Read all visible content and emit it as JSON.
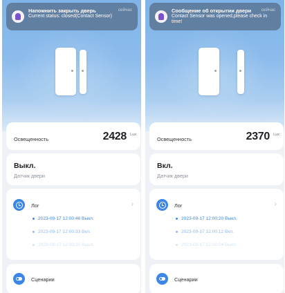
{
  "left": {
    "notification": {
      "title": "Напомнить закрыть дверь",
      "body": "Current status: closed(Contact Sensor)",
      "time": "сейчас"
    },
    "illuminance": {
      "label": "Освещенность",
      "value": "2428",
      "unit": "Lux"
    },
    "status": {
      "title": "Выкл.",
      "subtitle": "Датчик двери"
    },
    "log": {
      "label": "Лог",
      "entries": [
        "2023-09-17 12:00:46 Выкл.",
        "2023-09-17 12:00:33 Вкл.",
        "2023-09-17 12:00:20 Выкл."
      ]
    },
    "scenarios": {
      "label": "Сценарии"
    }
  },
  "right": {
    "notification": {
      "title": "Сообщение об открытии двери",
      "body": "Contact Sensor was opened,please check in time!",
      "time": "сейчас"
    },
    "illuminance": {
      "label": "Освещенность",
      "value": "2370",
      "unit": "Lux"
    },
    "status": {
      "title": "Вкл.",
      "subtitle": "Датчик двери"
    },
    "log": {
      "label": "Лог",
      "entries": [
        "2023-09-17 12:00:20 Выкл.",
        "2023-09-17 12:00:12 Вкл.",
        "2023-09-17 12:00:04 Выкл."
      ]
    },
    "scenarios": {
      "label": "Сценарии"
    }
  },
  "icons": {
    "app": "lightbulb-icon",
    "log": "clock-icon",
    "log_more": "chevron-right-icon",
    "scenarios": "toggle-icon"
  },
  "colors": {
    "accent": "#3b86e6",
    "hero_top": "#7fb4e8",
    "background": "#eef1f5"
  }
}
